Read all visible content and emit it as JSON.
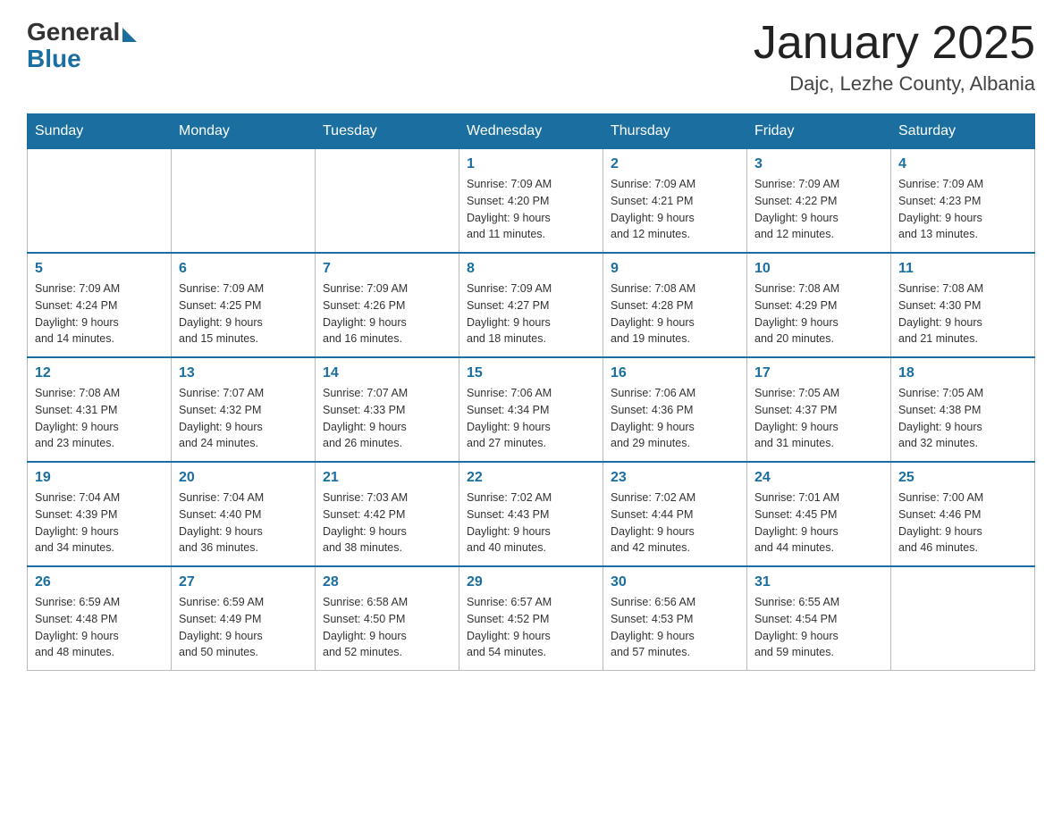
{
  "header": {
    "logo_general": "General",
    "logo_blue": "Blue",
    "month_title": "January 2025",
    "location": "Dajc, Lezhe County, Albania"
  },
  "days_of_week": [
    "Sunday",
    "Monday",
    "Tuesday",
    "Wednesday",
    "Thursday",
    "Friday",
    "Saturday"
  ],
  "weeks": [
    [
      {
        "day": "",
        "info": ""
      },
      {
        "day": "",
        "info": ""
      },
      {
        "day": "",
        "info": ""
      },
      {
        "day": "1",
        "info": "Sunrise: 7:09 AM\nSunset: 4:20 PM\nDaylight: 9 hours\nand 11 minutes."
      },
      {
        "day": "2",
        "info": "Sunrise: 7:09 AM\nSunset: 4:21 PM\nDaylight: 9 hours\nand 12 minutes."
      },
      {
        "day": "3",
        "info": "Sunrise: 7:09 AM\nSunset: 4:22 PM\nDaylight: 9 hours\nand 12 minutes."
      },
      {
        "day": "4",
        "info": "Sunrise: 7:09 AM\nSunset: 4:23 PM\nDaylight: 9 hours\nand 13 minutes."
      }
    ],
    [
      {
        "day": "5",
        "info": "Sunrise: 7:09 AM\nSunset: 4:24 PM\nDaylight: 9 hours\nand 14 minutes."
      },
      {
        "day": "6",
        "info": "Sunrise: 7:09 AM\nSunset: 4:25 PM\nDaylight: 9 hours\nand 15 minutes."
      },
      {
        "day": "7",
        "info": "Sunrise: 7:09 AM\nSunset: 4:26 PM\nDaylight: 9 hours\nand 16 minutes."
      },
      {
        "day": "8",
        "info": "Sunrise: 7:09 AM\nSunset: 4:27 PM\nDaylight: 9 hours\nand 18 minutes."
      },
      {
        "day": "9",
        "info": "Sunrise: 7:08 AM\nSunset: 4:28 PM\nDaylight: 9 hours\nand 19 minutes."
      },
      {
        "day": "10",
        "info": "Sunrise: 7:08 AM\nSunset: 4:29 PM\nDaylight: 9 hours\nand 20 minutes."
      },
      {
        "day": "11",
        "info": "Sunrise: 7:08 AM\nSunset: 4:30 PM\nDaylight: 9 hours\nand 21 minutes."
      }
    ],
    [
      {
        "day": "12",
        "info": "Sunrise: 7:08 AM\nSunset: 4:31 PM\nDaylight: 9 hours\nand 23 minutes."
      },
      {
        "day": "13",
        "info": "Sunrise: 7:07 AM\nSunset: 4:32 PM\nDaylight: 9 hours\nand 24 minutes."
      },
      {
        "day": "14",
        "info": "Sunrise: 7:07 AM\nSunset: 4:33 PM\nDaylight: 9 hours\nand 26 minutes."
      },
      {
        "day": "15",
        "info": "Sunrise: 7:06 AM\nSunset: 4:34 PM\nDaylight: 9 hours\nand 27 minutes."
      },
      {
        "day": "16",
        "info": "Sunrise: 7:06 AM\nSunset: 4:36 PM\nDaylight: 9 hours\nand 29 minutes."
      },
      {
        "day": "17",
        "info": "Sunrise: 7:05 AM\nSunset: 4:37 PM\nDaylight: 9 hours\nand 31 minutes."
      },
      {
        "day": "18",
        "info": "Sunrise: 7:05 AM\nSunset: 4:38 PM\nDaylight: 9 hours\nand 32 minutes."
      }
    ],
    [
      {
        "day": "19",
        "info": "Sunrise: 7:04 AM\nSunset: 4:39 PM\nDaylight: 9 hours\nand 34 minutes."
      },
      {
        "day": "20",
        "info": "Sunrise: 7:04 AM\nSunset: 4:40 PM\nDaylight: 9 hours\nand 36 minutes."
      },
      {
        "day": "21",
        "info": "Sunrise: 7:03 AM\nSunset: 4:42 PM\nDaylight: 9 hours\nand 38 minutes."
      },
      {
        "day": "22",
        "info": "Sunrise: 7:02 AM\nSunset: 4:43 PM\nDaylight: 9 hours\nand 40 minutes."
      },
      {
        "day": "23",
        "info": "Sunrise: 7:02 AM\nSunset: 4:44 PM\nDaylight: 9 hours\nand 42 minutes."
      },
      {
        "day": "24",
        "info": "Sunrise: 7:01 AM\nSunset: 4:45 PM\nDaylight: 9 hours\nand 44 minutes."
      },
      {
        "day": "25",
        "info": "Sunrise: 7:00 AM\nSunset: 4:46 PM\nDaylight: 9 hours\nand 46 minutes."
      }
    ],
    [
      {
        "day": "26",
        "info": "Sunrise: 6:59 AM\nSunset: 4:48 PM\nDaylight: 9 hours\nand 48 minutes."
      },
      {
        "day": "27",
        "info": "Sunrise: 6:59 AM\nSunset: 4:49 PM\nDaylight: 9 hours\nand 50 minutes."
      },
      {
        "day": "28",
        "info": "Sunrise: 6:58 AM\nSunset: 4:50 PM\nDaylight: 9 hours\nand 52 minutes."
      },
      {
        "day": "29",
        "info": "Sunrise: 6:57 AM\nSunset: 4:52 PM\nDaylight: 9 hours\nand 54 minutes."
      },
      {
        "day": "30",
        "info": "Sunrise: 6:56 AM\nSunset: 4:53 PM\nDaylight: 9 hours\nand 57 minutes."
      },
      {
        "day": "31",
        "info": "Sunrise: 6:55 AM\nSunset: 4:54 PM\nDaylight: 9 hours\nand 59 minutes."
      },
      {
        "day": "",
        "info": ""
      }
    ]
  ]
}
